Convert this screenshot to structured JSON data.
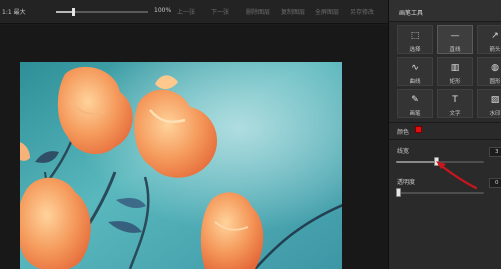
{
  "toolbar": {
    "zoom_label": "1:1 最大",
    "zoom_value": "100%",
    "zoom_fraction": 1.0,
    "prev_label": "上一张",
    "next_label": "下一张",
    "delete_label": "删除图层",
    "copy_label": "复制图层",
    "full_label": "全屏图层",
    "save_label": "另存修改"
  },
  "sidebar": {
    "title": "画笔工具",
    "tools": [
      {
        "label": "选择",
        "icon": "selection-icon",
        "glyph": "⬚"
      },
      {
        "label": "直线",
        "icon": "line-icon",
        "glyph": "—"
      },
      {
        "label": "箭头",
        "icon": "arrow-tool-icon",
        "glyph": "↗"
      },
      {
        "label": "曲线",
        "icon": "curve-icon",
        "glyph": "∿"
      },
      {
        "label": "矩形",
        "icon": "rectangle-icon",
        "glyph": "▥"
      },
      {
        "label": "圆形",
        "icon": "circle-icon",
        "glyph": "◍"
      },
      {
        "label": "画笔",
        "icon": "brush-icon",
        "glyph": "✎"
      },
      {
        "label": "文字",
        "icon": "text-tool-icon",
        "glyph": "T"
      },
      {
        "label": "水印",
        "icon": "watermark-icon",
        "glyph": "▨"
      }
    ],
    "selected_tool": "直线",
    "color_label": "颜色",
    "color_value": "#e01010",
    "width_label": "线宽",
    "width_value": "3",
    "width_fraction": 0.45,
    "opacity_label": "透明度",
    "opacity_value": "0",
    "opacity_fraction": 0.0
  },
  "colors": {
    "annotation_arrow": "#c8161d",
    "sky": "#4fb0b6",
    "petal": "#f39a5a"
  }
}
